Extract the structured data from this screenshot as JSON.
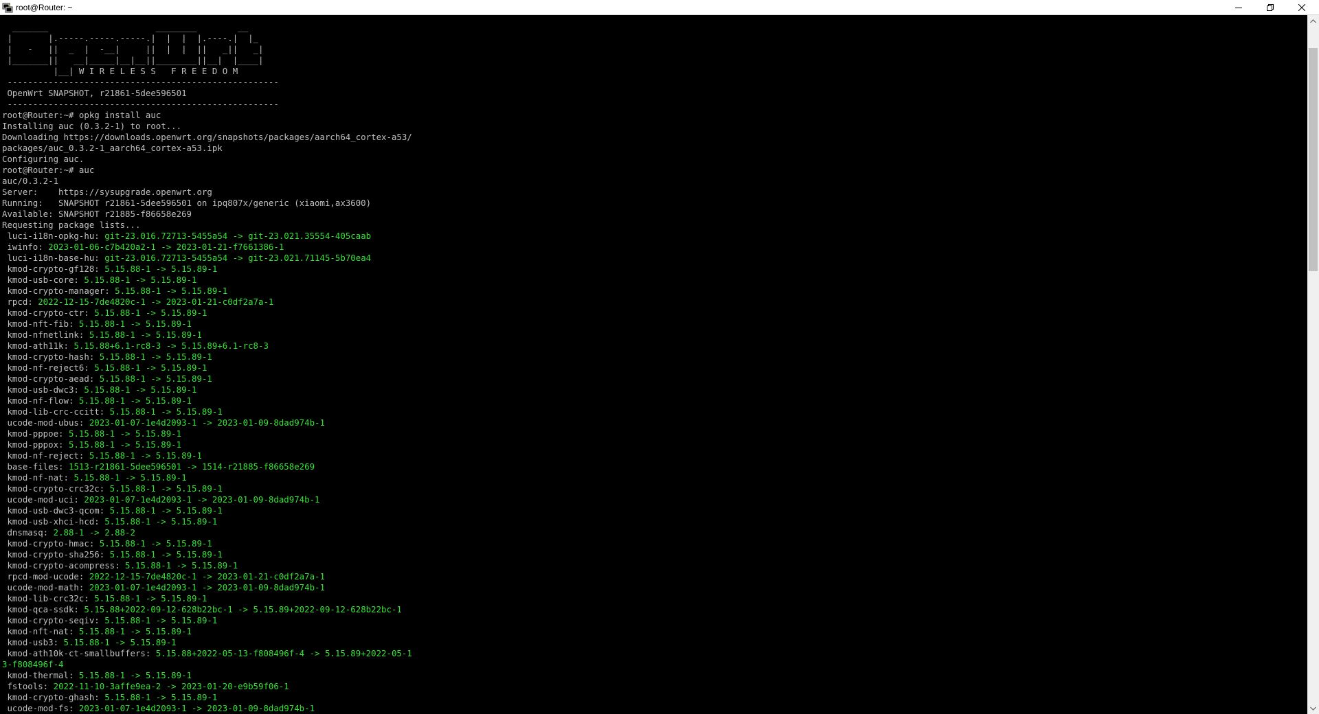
{
  "window": {
    "title": "root@Router: ~",
    "icon": "putty-terminal-icon"
  },
  "controls": {
    "minimize_icon": "minimize-icon",
    "maximize_icon": "restore-icon",
    "close_icon": "close-icon"
  },
  "colors": {
    "background": "#000000",
    "text": "#c0c0c0",
    "version": "#37e237",
    "titlebar": "#ffffff"
  },
  "terminal": {
    "lines": [
      {
        "text": "  _______                     ________        __"
      },
      {
        "text": " |       |.-----.-----.-----.|  |  |  |.----.|  |_"
      },
      {
        "text": " |   -   ||  _  |  -__|     ||  |  |  ||   _||   _|"
      },
      {
        "text": " |_______||   __|_____|__|__||________||__|  |____|"
      },
      {
        "text": "          |__| W I R E L E S S   F R E E D O M"
      },
      {
        "text": " -----------------------------------------------------"
      },
      {
        "text": " OpenWrt SNAPSHOT, r21861-5dee596501"
      },
      {
        "text": " -----------------------------------------------------"
      },
      {
        "text": "root@Router:~# opkg install auc"
      },
      {
        "text": "Installing auc (0.3.2-1) to root..."
      },
      {
        "text": "Downloading https://downloads.openwrt.org/snapshots/packages/aarch64_cortex-a53/"
      },
      {
        "text": "packages/auc_0.3.2-1_aarch64_cortex-a53.ipk"
      },
      {
        "text": "Configuring auc."
      },
      {
        "text": "root@Router:~# auc"
      },
      {
        "text": "auc/0.3.2-1"
      },
      {
        "text": "Server:    https://sysupgrade.openwrt.org"
      },
      {
        "text": "Running:   SNAPSHOT r21861-5dee596501 on ipq807x/generic (xiaomi,ax3600)"
      },
      {
        "text": "Available: SNAPSHOT r21885-f86658e269"
      },
      {
        "text": "Requesting package lists..."
      },
      {
        "name": " luci-i18n-opkg-hu: ",
        "version": "git-23.016.72713-5455a54 -> git-23.021.35554-405caab"
      },
      {
        "name": " iwinfo: ",
        "version": "2023-01-06-c7b420a2-1 -> 2023-01-21-f7661386-1"
      },
      {
        "name": " luci-i18n-base-hu: ",
        "version": "git-23.016.72713-5455a54 -> git-23.021.71145-5b70ea4"
      },
      {
        "name": " kmod-crypto-gf128: ",
        "version": "5.15.88-1 -> 5.15.89-1"
      },
      {
        "name": " kmod-usb-core: ",
        "version": "5.15.88-1 -> 5.15.89-1"
      },
      {
        "name": " kmod-crypto-manager: ",
        "version": "5.15.88-1 -> 5.15.89-1"
      },
      {
        "name": " rpcd: ",
        "version": "2022-12-15-7de4820c-1 -> 2023-01-21-c0df2a7a-1"
      },
      {
        "name": " kmod-crypto-ctr: ",
        "version": "5.15.88-1 -> 5.15.89-1"
      },
      {
        "name": " kmod-nft-fib: ",
        "version": "5.15.88-1 -> 5.15.89-1"
      },
      {
        "name": " kmod-nfnetlink: ",
        "version": "5.15.88-1 -> 5.15.89-1"
      },
      {
        "name": " kmod-ath11k: ",
        "version": "5.15.88+6.1-rc8-3 -> 5.15.89+6.1-rc8-3"
      },
      {
        "name": " kmod-crypto-hash: ",
        "version": "5.15.88-1 -> 5.15.89-1"
      },
      {
        "name": " kmod-nf-reject6: ",
        "version": "5.15.88-1 -> 5.15.89-1"
      },
      {
        "name": " kmod-crypto-aead: ",
        "version": "5.15.88-1 -> 5.15.89-1"
      },
      {
        "name": " kmod-usb-dwc3: ",
        "version": "5.15.88-1 -> 5.15.89-1"
      },
      {
        "name": " kmod-nf-flow: ",
        "version": "5.15.88-1 -> 5.15.89-1"
      },
      {
        "name": " kmod-lib-crc-ccitt: ",
        "version": "5.15.88-1 -> 5.15.89-1"
      },
      {
        "name": " ucode-mod-ubus: ",
        "version": "2023-01-07-1e4d2093-1 -> 2023-01-09-8dad974b-1"
      },
      {
        "name": " kmod-pppoe: ",
        "version": "5.15.88-1 -> 5.15.89-1"
      },
      {
        "name": " kmod-pppox: ",
        "version": "5.15.88-1 -> 5.15.89-1"
      },
      {
        "name": " kmod-nf-reject: ",
        "version": "5.15.88-1 -> 5.15.89-1"
      },
      {
        "name": " base-files: ",
        "version": "1513-r21861-5dee596501 -> 1514-r21885-f86658e269"
      },
      {
        "name": " kmod-nf-nat: ",
        "version": "5.15.88-1 -> 5.15.89-1"
      },
      {
        "name": " kmod-crypto-crc32c: ",
        "version": "5.15.88-1 -> 5.15.89-1"
      },
      {
        "name": " ucode-mod-uci: ",
        "version": "2023-01-07-1e4d2093-1 -> 2023-01-09-8dad974b-1"
      },
      {
        "name": " kmod-usb-dwc3-qcom: ",
        "version": "5.15.88-1 -> 5.15.89-1"
      },
      {
        "name": " kmod-usb-xhci-hcd: ",
        "version": "5.15.88-1 -> 5.15.89-1"
      },
      {
        "name": " dnsmasq: ",
        "version": "2.88-1 -> 2.88-2"
      },
      {
        "name": " kmod-crypto-hmac: ",
        "version": "5.15.88-1 -> 5.15.89-1"
      },
      {
        "name": " kmod-crypto-sha256: ",
        "version": "5.15.88-1 -> 5.15.89-1"
      },
      {
        "name": " kmod-crypto-acompress: ",
        "version": "5.15.88-1 -> 5.15.89-1"
      },
      {
        "name": " rpcd-mod-ucode: ",
        "version": "2022-12-15-7de4820c-1 -> 2023-01-21-c0df2a7a-1"
      },
      {
        "name": " ucode-mod-math: ",
        "version": "2023-01-07-1e4d2093-1 -> 2023-01-09-8dad974b-1"
      },
      {
        "name": " kmod-lib-crc32c: ",
        "version": "5.15.88-1 -> 5.15.89-1"
      },
      {
        "name": " kmod-qca-ssdk: ",
        "version": "5.15.88+2022-09-12-628b22bc-1 -> 5.15.89+2022-09-12-628b22bc-1"
      },
      {
        "name": " kmod-crypto-seqiv: ",
        "version": "5.15.88-1 -> 5.15.89-1"
      },
      {
        "name": " kmod-nft-nat: ",
        "version": "5.15.88-1 -> 5.15.89-1"
      },
      {
        "name": " kmod-usb3: ",
        "version": "5.15.88-1 -> 5.15.89-1"
      },
      {
        "name": " kmod-ath10k-ct-smallbuffers: ",
        "version": "5.15.88+2022-05-13-f808496f-4 -> 5.15.89+2022-05-1"
      },
      {
        "version": "3-f808496f-4"
      },
      {
        "name": " kmod-thermal: ",
        "version": "5.15.88-1 -> 5.15.89-1"
      },
      {
        "name": " fstools: ",
        "version": "2022-11-10-3affe9ea-2 -> 2023-01-20-e9b59f06-1"
      },
      {
        "name": " kmod-crypto-ghash: ",
        "version": "5.15.88-1 -> 5.15.89-1"
      },
      {
        "name": " ucode-mod-fs: ",
        "version": "2023-01-07-1e4d2093-1 -> 2023-01-09-8dad974b-1"
      }
    ]
  },
  "scrollbar": {
    "position": 0.0,
    "visible_fraction": 0.33
  }
}
